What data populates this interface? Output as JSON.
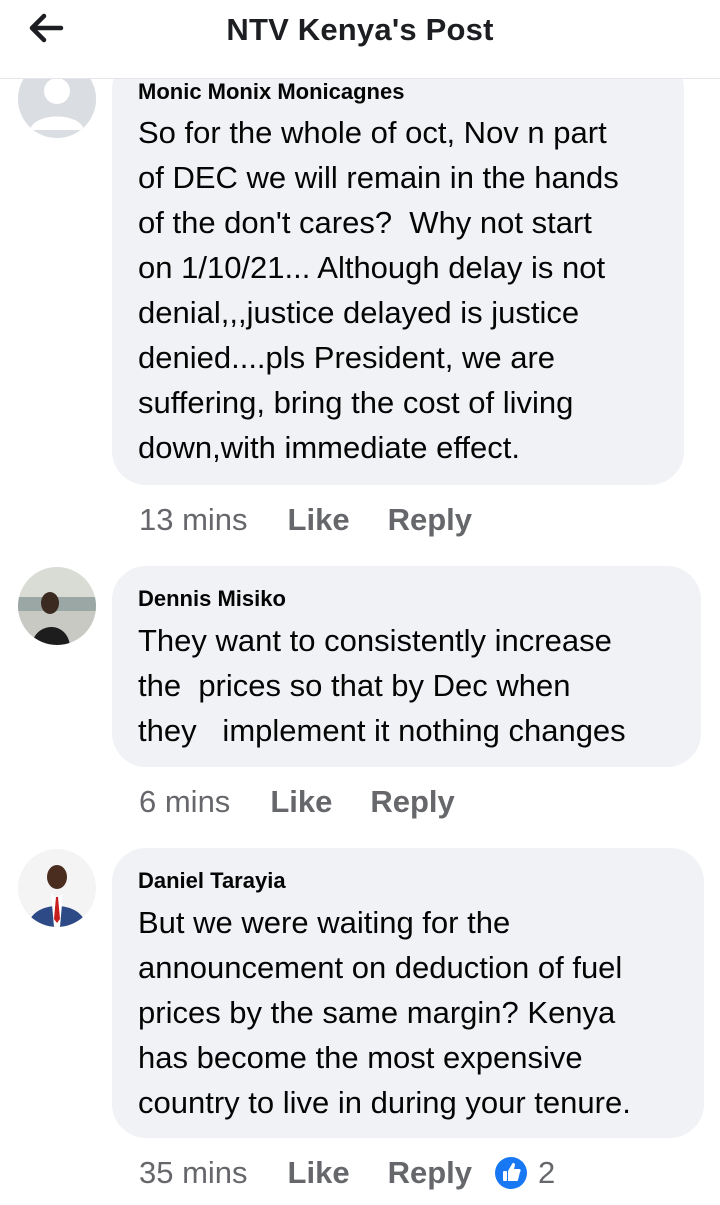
{
  "header": {
    "title": "NTV Kenya's Post"
  },
  "comments": [
    {
      "author": "Monic Monix Monicagnes",
      "text": "So for the whole of oct, Nov n part\nof DEC we will remain in the hands\nof the don't cares?  Why not start\non 1/10/21... Although delay is not\ndenial,,,justice delayed is justice\ndenied....pls President, we are\nsuffering, bring the cost of living\ndown,with immediate effect.",
      "time": "13 mins",
      "like_label": "Like",
      "reply_label": "Reply"
    },
    {
      "author": "Dennis Misiko",
      "text": "They want to consistently increase\nthe  prices so that by Dec when\nthey   implement it nothing changes",
      "time": "6 mins",
      "like_label": "Like",
      "reply_label": "Reply"
    },
    {
      "author": "Daniel Tarayia",
      "text": "But we were waiting for the\nannouncement on deduction of fuel\nprices by the same margin? Kenya\nhas become the most expensive\ncountry to live in during your tenure.",
      "time": "35 mins",
      "like_label": "Like",
      "reply_label": "Reply",
      "reaction_count": "2"
    }
  ],
  "colors": {
    "bubble": "#f0f2f5",
    "meta_text": "#65676b",
    "like_reaction": "#1877f2"
  }
}
